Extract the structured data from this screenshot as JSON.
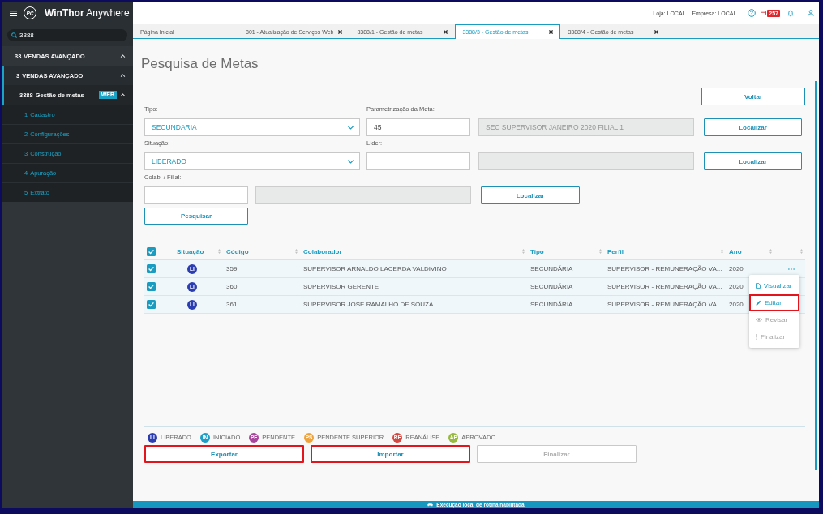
{
  "sidebar": {
    "logo": {
      "mark": "PC",
      "title": "**WinThor** Anywhere"
    },
    "search": {
      "value": "3388"
    },
    "menu": [
      {
        "code": "33",
        "label": "VENDAS AVANÇADO",
        "selected": false,
        "expanded": true,
        "children": [
          {
            "code": "3",
            "label": "VENDAS AVANÇADO",
            "selected": true,
            "expanded": true,
            "children": [
              {
                "code": "3388",
                "label": "Gestão de metas",
                "badge": "WEB",
                "selected": true,
                "expanded": true,
                "children": [
                  {
                    "code": "1",
                    "label": "Cadastro",
                    "selected": false
                  },
                  {
                    "code": "2",
                    "label": "Configurações",
                    "selected": false
                  },
                  {
                    "code": "3",
                    "label": "Construção",
                    "selected": false
                  },
                  {
                    "code": "4",
                    "label": "Apuração",
                    "selected": false
                  },
                  {
                    "code": "5",
                    "label": "Extrato",
                    "selected": false
                  }
                ]
              }
            ]
          }
        ]
      }
    ]
  },
  "header": {
    "store": "Loja: LOCAL",
    "company": "Empresa: LOCAL",
    "notification_count": "257"
  },
  "tabs": [
    {
      "label": "Página Inicial",
      "selected": false,
      "closable": false
    },
    {
      "label": "801 - Atualização de Serviços Web",
      "selected": false,
      "closable": true
    },
    {
      "label": "3388/1 - Gestão de metas",
      "selected": false,
      "closable": true
    },
    {
      "label": "3388/3 - Gestão de metas",
      "selected": true,
      "closable": true
    },
    {
      "label": "3388/4 - Gestão de metas",
      "selected": false,
      "closable": true
    }
  ],
  "page": {
    "title": "Pesquisa de Metas",
    "back_button": "Voltar",
    "form": {
      "tipo": {
        "label": "Tipo:",
        "value": "SECUNDARIA"
      },
      "parametrizacao": {
        "label": "Parametrização da Meta:",
        "value": "45",
        "description": {
          "value": "SEC SUPERVISOR JANEIRO 2020 FILIAL 1",
          "disabled": true
        },
        "button": "Localizar"
      },
      "situacao": {
        "label": "Situação:",
        "value": "LIBERADO"
      },
      "lider": {
        "label": "Líder:",
        "description": {
          "disabled": true
        },
        "button": "Localizar"
      },
      "colab": {
        "label": "Colab. / Filial:",
        "description": {
          "disabled": true
        },
        "button": "Localizar"
      },
      "search_button": "Pesquisar"
    },
    "table": {
      "all_checked": true,
      "columns": [
        {
          "label": "Situação",
          "sortable": true
        },
        {
          "label": "Código",
          "sortable": true
        },
        {
          "label": "Colaborador",
          "sortable": true
        },
        {
          "label": "Tipo",
          "sortable": true
        },
        {
          "label": "Perfil",
          "sortable": true
        },
        {
          "label": "Ano",
          "sortable": true
        },
        {
          "sortable": true
        }
      ],
      "rows": [
        {
          "checked": true,
          "status": {
            "abbr": "LI",
            "color": "#2b3db3"
          },
          "code": "359",
          "colaborador": "SUPERVISOR ARNALDO LACERDA VALDIVINO",
          "tipo": "SECUNDÁRIA",
          "perfil": "SUPERVISOR - REMUNERAÇÃO VA...",
          "ano": "2020",
          "menu_open": true
        },
        {
          "checked": true,
          "status": {
            "abbr": "LI",
            "color": "#2b3db3"
          },
          "code": "360",
          "colaborador": "SUPERVISOR GERENTE",
          "tipo": "SECUNDÁRIA",
          "perfil": "SUPERVISOR - REMUNERAÇÃO VA...",
          "ano": "2020",
          "menu_open": false
        },
        {
          "checked": true,
          "status": {
            "abbr": "LI",
            "color": "#2b3db3"
          },
          "code": "361",
          "colaborador": "SUPERVISOR JOSE RAMALHO DE SOUZA",
          "tipo": "SECUNDÁRIA",
          "perfil": "SUPERVISOR - REMUNERAÇÃO VA...",
          "ano": "2020",
          "menu_open": false
        }
      ],
      "row_menu": [
        {
          "kind": "view",
          "label": "Visualizar",
          "disabled": false,
          "highlighted": false
        },
        {
          "kind": "edit",
          "label": "Editar",
          "disabled": false,
          "highlighted": true
        },
        {
          "kind": "review",
          "label": "Revisar",
          "disabled": true,
          "highlighted": false
        },
        {
          "kind": "finish",
          "label": "Finalizar",
          "disabled": true,
          "highlighted": false
        }
      ]
    },
    "legend": [
      {
        "abbr": "LI",
        "label": "LIBERADO",
        "color": "#2b3db3"
      },
      {
        "abbr": "IN",
        "label": "INICIADO",
        "color": "#1c9ec6"
      },
      {
        "abbr": "PE",
        "label": "PENDENTE",
        "color": "#a8459c"
      },
      {
        "abbr": "PS",
        "label": "PENDENTE SUPERIOR",
        "color": "#f0a23a"
      },
      {
        "abbr": "RE",
        "label": "REANÁLISE",
        "color": "#d7463f"
      },
      {
        "abbr": "AP",
        "label": "APROVADO",
        "color": "#96ba3c"
      }
    ],
    "actions": [
      {
        "label": "Exportar",
        "disabled": false,
        "highlighted": true
      },
      {
        "label": "Importar",
        "disabled": false,
        "highlighted": true
      },
      {
        "label": "Finalizar",
        "disabled": true,
        "highlighted": false
      }
    ]
  },
  "status_bar": {
    "text": "Execução local de rotina habilitada"
  }
}
